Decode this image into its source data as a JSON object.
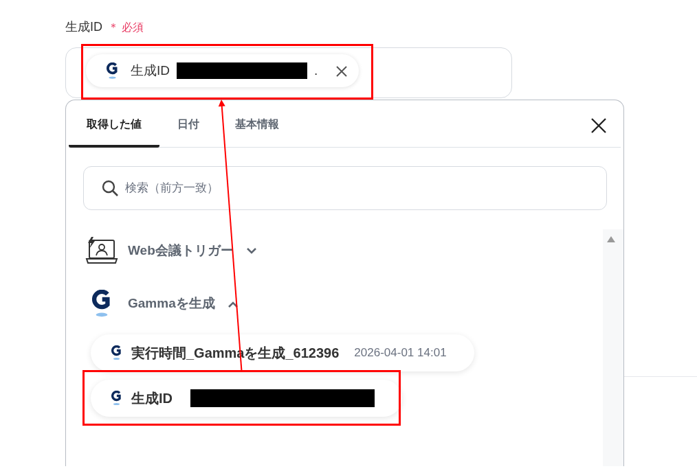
{
  "field": {
    "label": "生成ID",
    "required_mark": "＊",
    "required_text": "必須",
    "chip": {
      "label": "生成ID",
      "ellipsis": ".",
      "redacted": true,
      "highlighted": true
    }
  },
  "popup": {
    "tabs": [
      {
        "label": "取得した値",
        "selected": true
      },
      {
        "label": "日付",
        "selected": false
      },
      {
        "label": "基本情報",
        "selected": false
      }
    ],
    "search": {
      "placeholder": "検索（前方一致）"
    },
    "groups": [
      {
        "kind": "trigger",
        "label": "Web会議トリガー",
        "expanded": false
      },
      {
        "kind": "gamma",
        "label": "Gammaを生成",
        "expanded": true,
        "items": [
          {
            "label": "実行時間_Gammaを生成_612396",
            "time": "2026-04-01 14:01",
            "redacted": false,
            "highlighted": false
          },
          {
            "label": "生成ID",
            "redacted": true,
            "highlighted": true
          }
        ]
      }
    ]
  },
  "annotation_arrow": true
}
